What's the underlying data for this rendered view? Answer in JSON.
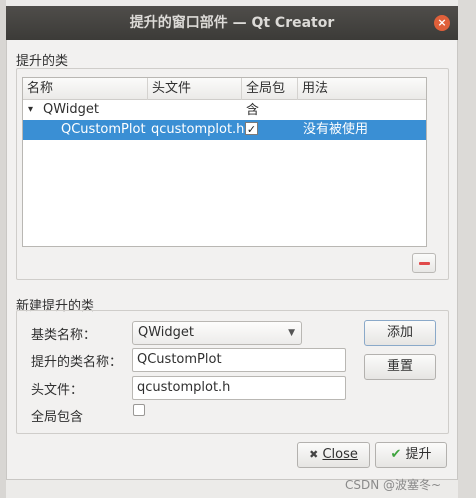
{
  "window": {
    "title": "提升的窗口部件 — Qt Creator",
    "close_symbol": "×"
  },
  "promoted_group": {
    "title": "提升的类"
  },
  "tree": {
    "columns": [
      "名称",
      "头文件",
      "全局包含",
      "用法"
    ],
    "parent_item": {
      "expander": "▾",
      "name": "QWidget"
    },
    "child_item": {
      "name": "QCustomPlot",
      "header": "qcustomplot.h",
      "global_include_checked": true,
      "check_mark": "✓",
      "usage": "没有被使用"
    }
  },
  "new_group": {
    "title": "新建提升的类",
    "base_class_label": "基类名称：",
    "base_class_value": "QWidget",
    "promoted_class_label": "提升的类名称：",
    "promoted_class_value": "QCustomPlot",
    "header_label": "头文件：",
    "header_value": "qcustomplot.h",
    "global_include_label": "全局包含",
    "add_button": "添加",
    "reset_button": "重置"
  },
  "footer": {
    "close_button": "Close",
    "close_icon": "✖",
    "promote_button": "提升",
    "promote_icon": "✔"
  },
  "watermark": "CSDN @波塞冬~",
  "colors": {
    "selection": "#3a8fd4",
    "remove_icon": "#e04a4a",
    "check_icon": "#3ea43e"
  }
}
